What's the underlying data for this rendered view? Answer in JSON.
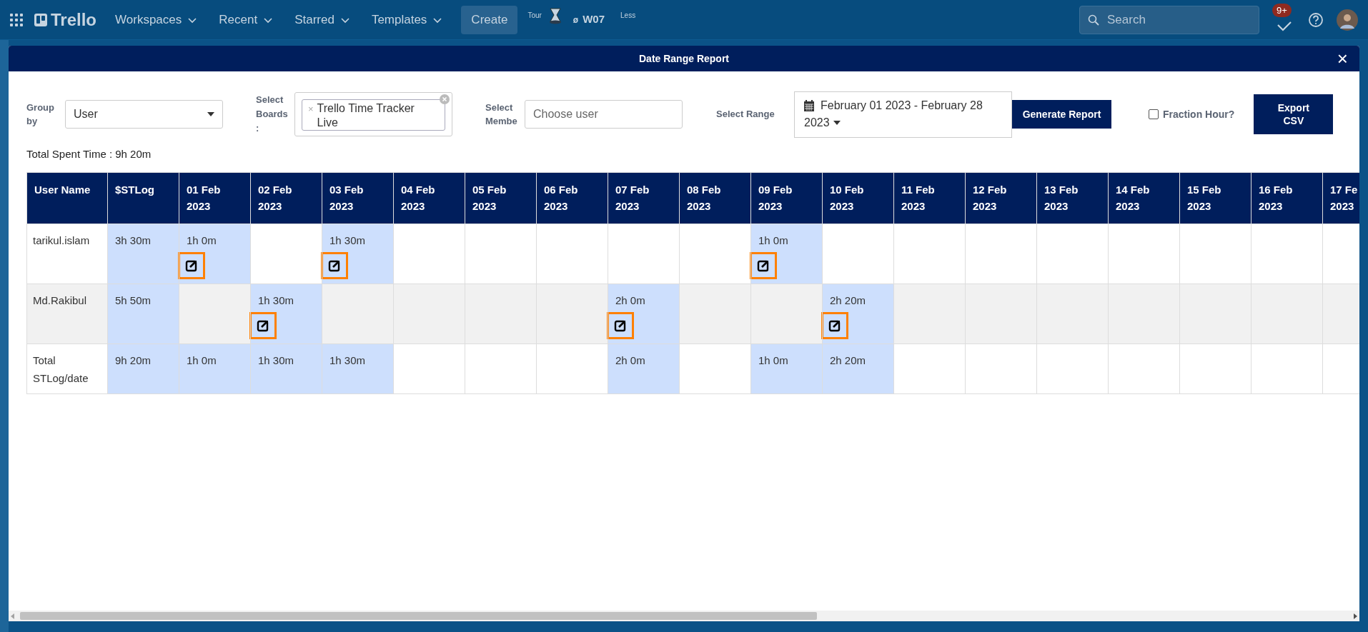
{
  "topbar": {
    "brand": "Trello",
    "menus": [
      {
        "label": "Workspaces"
      },
      {
        "label": "Recent"
      },
      {
        "label": "Starred"
      },
      {
        "label": "Templates"
      }
    ],
    "create": "Create",
    "tour": "Tour",
    "extra_mark": "ø",
    "extra_code": "W07",
    "less": "Less",
    "search": {
      "placeholder": "Search"
    },
    "notification_badge": "9+"
  },
  "modal": {
    "title": "Date Range Report",
    "close": "×",
    "filters": {
      "group_by": {
        "label_lines": [
          "Group",
          "by"
        ],
        "value": "User"
      },
      "boards": {
        "label_lines": [
          "Select",
          "Boards",
          ":"
        ],
        "remove": "×",
        "tag_lines": [
          "Trello Time Tracker",
          "Live"
        ]
      },
      "member": {
        "label_lines": [
          "Select",
          "Membe"
        ],
        "placeholder": "Choose user"
      },
      "range": {
        "label": "Select Range",
        "value_lines": [
          "February 01 2023 - February 28",
          "2023"
        ]
      },
      "generate": "Generate Report",
      "fraction": {
        "label": "Fraction Hour?",
        "checked": false
      },
      "export_lines": [
        "Export",
        "CSV"
      ]
    },
    "total": "Total Spent Time : 9h 20m",
    "table": {
      "columns": [
        "User Name",
        "$STLog",
        "01 Feb 2023",
        "02 Feb 2023",
        "03 Feb 2023",
        "04 Feb 2023",
        "05 Feb 2023",
        "06 Feb 2023",
        "07 Feb 2023",
        "08 Feb 2023",
        "09 Feb 2023",
        "10 Feb 2023",
        "11 Feb 2023",
        "12 Feb 2023",
        "13 Feb 2023",
        "14 Feb 2023",
        "15 Feb 2023",
        "16 Feb 2023",
        "17 Fe 2023"
      ],
      "rows": [
        {
          "shaded": false,
          "cells": [
            {
              "value": "tarikul.islam",
              "filled": false,
              "editable": false
            },
            {
              "value": "3h 30m",
              "filled": true,
              "editable": false
            },
            {
              "value": "1h 0m",
              "filled": true,
              "editable": true
            },
            {
              "filled": false,
              "editable": false
            },
            {
              "value": "1h 30m",
              "filled": true,
              "editable": true
            },
            {
              "filled": false,
              "editable": false
            },
            {
              "filled": false,
              "editable": false
            },
            {
              "filled": false,
              "editable": false
            },
            {
              "filled": false,
              "editable": false
            },
            {
              "filled": false,
              "editable": false
            },
            {
              "value": "1h 0m",
              "filled": true,
              "editable": true
            },
            {
              "filled": false,
              "editable": false
            },
            {
              "filled": false,
              "editable": false
            },
            {
              "filled": false,
              "editable": false
            },
            {
              "filled": false,
              "editable": false
            },
            {
              "filled": false,
              "editable": false
            },
            {
              "filled": false,
              "editable": false
            },
            {
              "filled": false,
              "editable": false
            },
            {
              "filled": false,
              "editable": false
            }
          ]
        },
        {
          "shaded": true,
          "cells": [
            {
              "value": "Md.Rakibul",
              "filled": false,
              "editable": false
            },
            {
              "value": "5h 50m",
              "filled": true,
              "editable": false
            },
            {
              "filled": false,
              "editable": false
            },
            {
              "value": "1h 30m",
              "filled": true,
              "editable": true
            },
            {
              "filled": false,
              "editable": false
            },
            {
              "filled": false,
              "editable": false
            },
            {
              "filled": false,
              "editable": false
            },
            {
              "filled": false,
              "editable": false
            },
            {
              "value": "2h 0m",
              "filled": true,
              "editable": true
            },
            {
              "filled": false,
              "editable": false
            },
            {
              "filled": false,
              "editable": false
            },
            {
              "value": "2h 20m",
              "filled": true,
              "editable": true
            },
            {
              "filled": false,
              "editable": false
            },
            {
              "filled": false,
              "editable": false
            },
            {
              "filled": false,
              "editable": false
            },
            {
              "filled": false,
              "editable": false
            },
            {
              "filled": false,
              "editable": false
            },
            {
              "filled": false,
              "editable": false
            },
            {
              "filled": false,
              "editable": false
            }
          ]
        },
        {
          "shaded": false,
          "cells": [
            {
              "value": "Total STLog/date",
              "filled": false,
              "editable": false
            },
            {
              "value": "9h 20m",
              "filled": true,
              "editable": false
            },
            {
              "value": "1h 0m",
              "filled": true,
              "editable": false
            },
            {
              "value": "1h 30m",
              "filled": true,
              "editable": false
            },
            {
              "value": "1h 30m",
              "filled": true,
              "editable": false
            },
            {
              "filled": false,
              "editable": false
            },
            {
              "filled": false,
              "editable": false
            },
            {
              "filled": false,
              "editable": false
            },
            {
              "value": "2h 0m",
              "filled": true,
              "editable": false
            },
            {
              "filled": false,
              "editable": false
            },
            {
              "value": "1h 0m",
              "filled": true,
              "editable": false
            },
            {
              "value": "2h 20m",
              "filled": true,
              "editable": false
            },
            {
              "filled": false,
              "editable": false
            },
            {
              "filled": false,
              "editable": false
            },
            {
              "filled": false,
              "editable": false
            },
            {
              "filled": false,
              "editable": false
            },
            {
              "filled": false,
              "editable": false
            },
            {
              "filled": false,
              "editable": false
            },
            {
              "filled": false,
              "editable": false
            }
          ]
        }
      ]
    }
  }
}
